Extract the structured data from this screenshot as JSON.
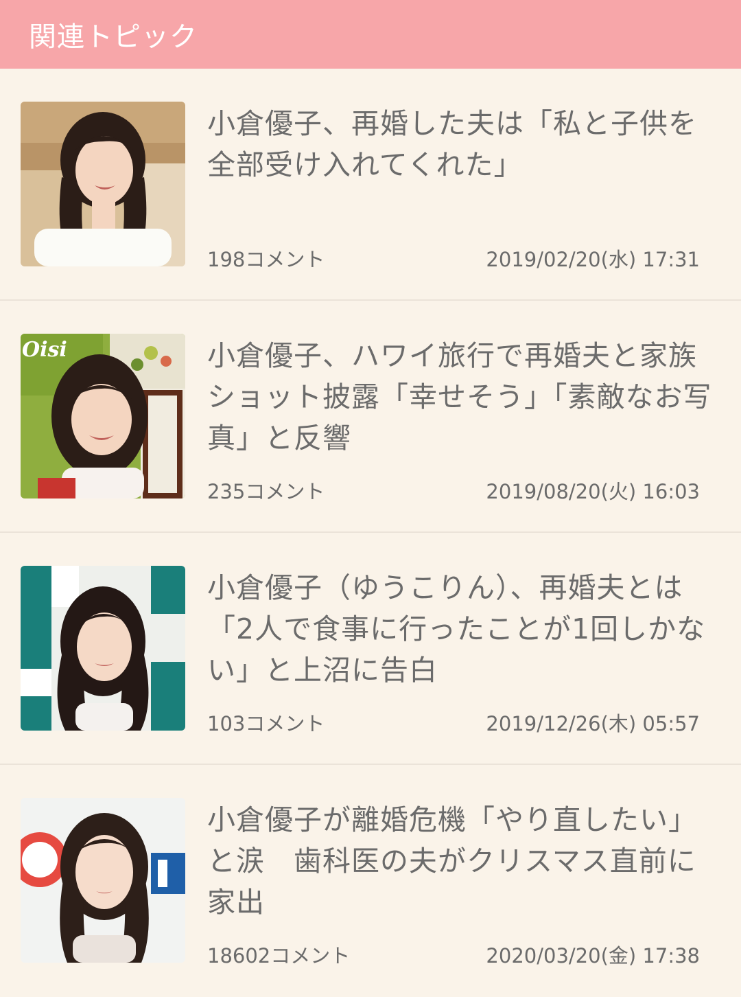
{
  "header": {
    "title": "関連トピック"
  },
  "topics": [
    {
      "title": "小倉優子、再婚した夫は「私と子供を全部受け入れてくれた」",
      "comments": "198コメント",
      "date": "2019/02/20(水) 17:31"
    },
    {
      "title": "小倉優子、ハワイ旅行で再婚夫と家族ショット披露「幸せそう」「素敵なお写真」と反響",
      "comments": "235コメント",
      "date": "2019/08/20(火) 16:03",
      "thumb_text": "Oisi"
    },
    {
      "title": "小倉優子（ゆうこりん）、再婚夫とは「2人で食事に行ったことが1回しかない」と上沼に告白",
      "comments": "103コメント",
      "date": "2019/12/26(木) 05:57"
    },
    {
      "title": "小倉優子が離婚危機「やり直したい」と涙　歯科医の夫がクリスマス直前に家出",
      "comments": "18602コメント",
      "date": "2020/03/20(金) 17:38"
    }
  ],
  "colors": {
    "header_bg": "#f7a6a9",
    "page_bg": "#faf3e9",
    "text": "#6b6b6b",
    "divider": "#ebe3d9"
  }
}
